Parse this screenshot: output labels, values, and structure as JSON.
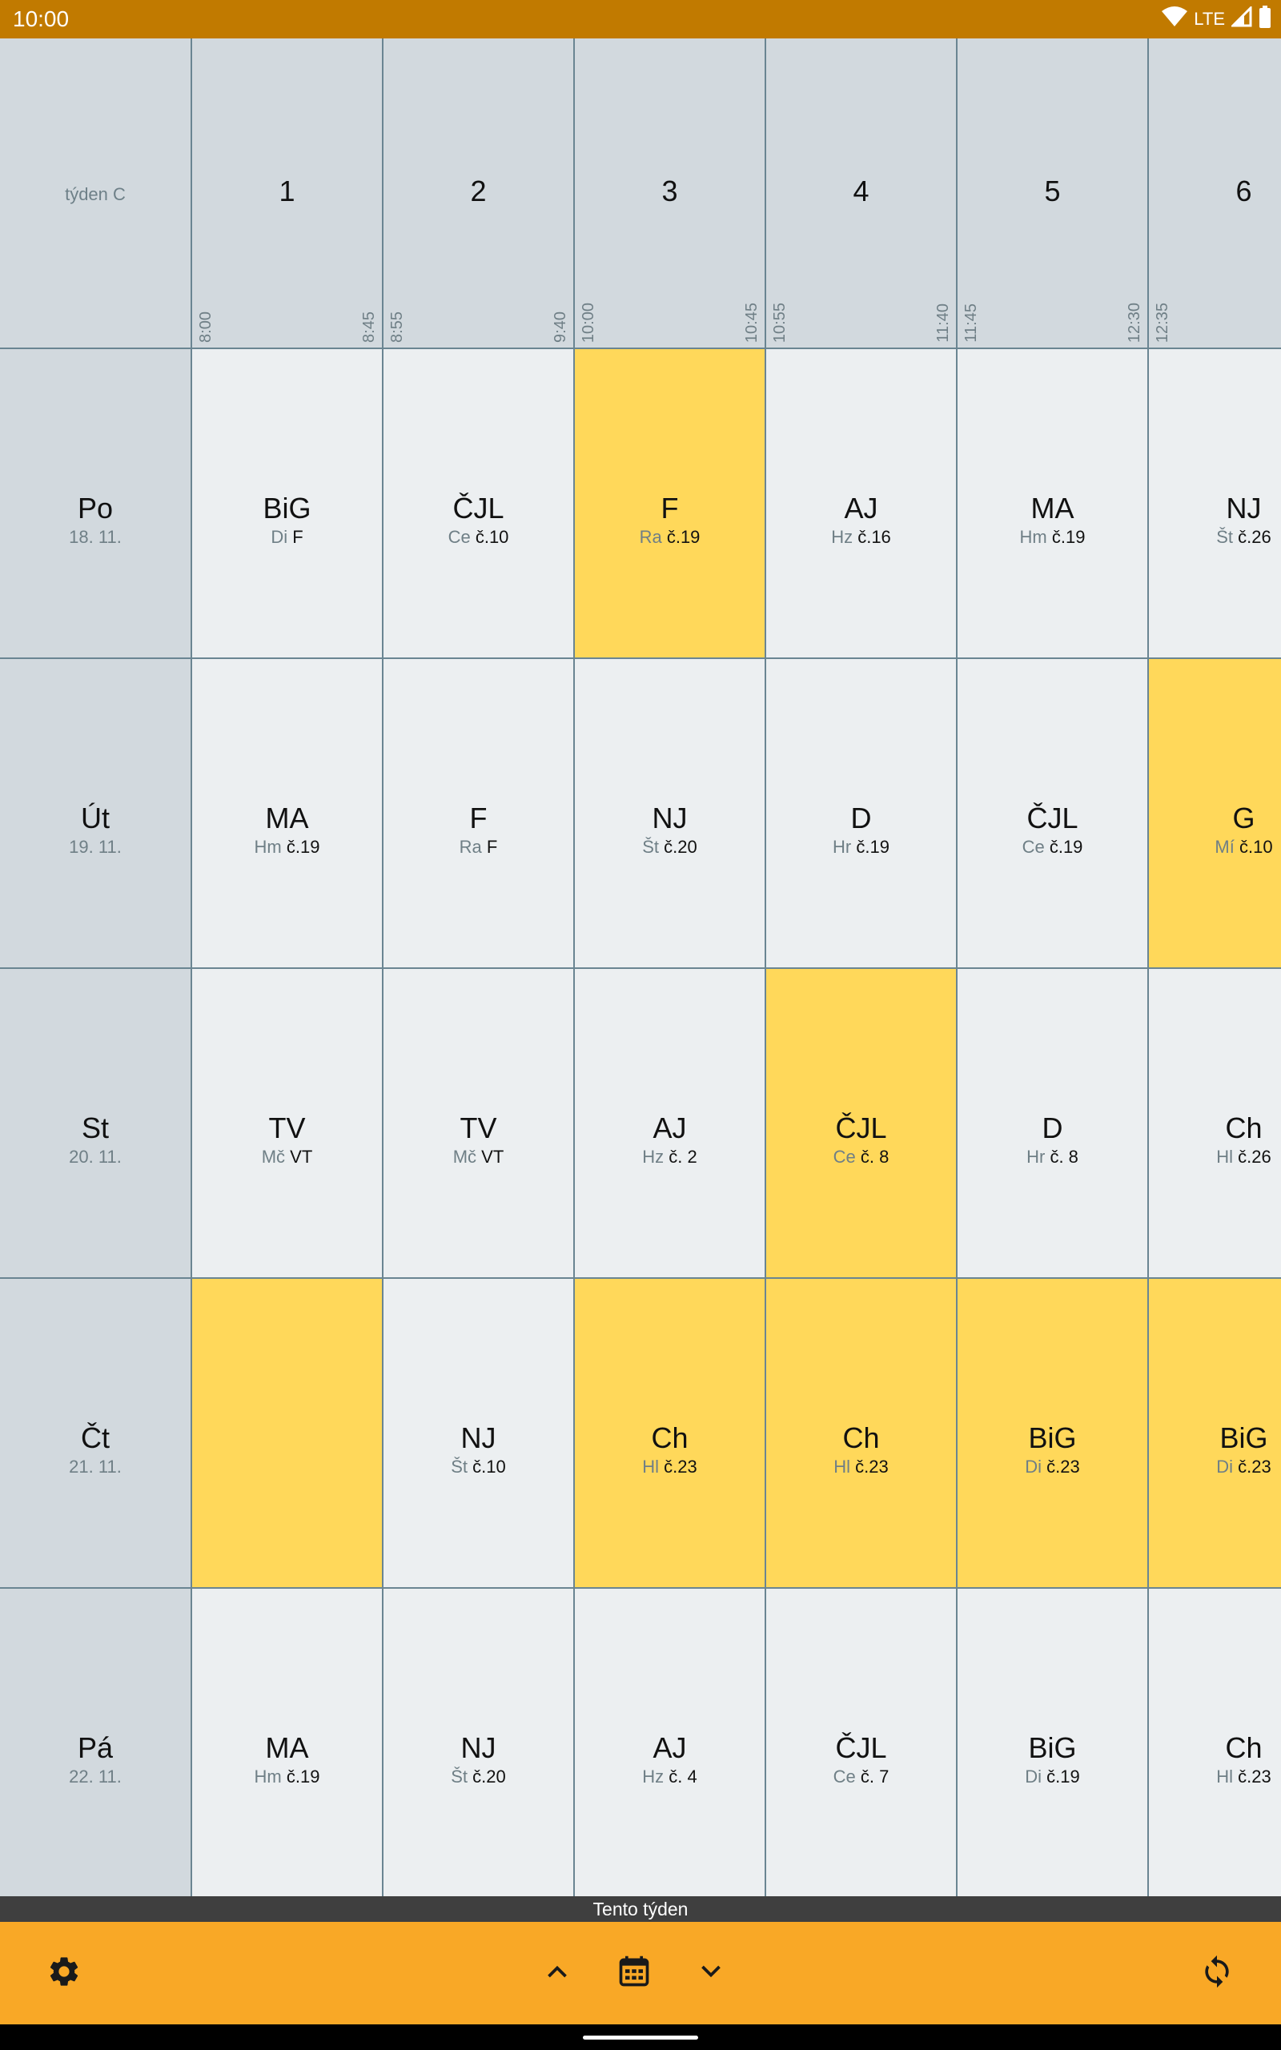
{
  "status_bar": {
    "time": "10:00",
    "network": "LTE"
  },
  "week_label": "týden C",
  "periods": [
    {
      "num": "1",
      "start": "8:00",
      "end": "8:45"
    },
    {
      "num": "2",
      "start": "8:55",
      "end": "9:40"
    },
    {
      "num": "3",
      "start": "10:00",
      "end": "10:45"
    },
    {
      "num": "4",
      "start": "10:55",
      "end": "11:40"
    },
    {
      "num": "5",
      "start": "11:45",
      "end": "12:30"
    },
    {
      "num": "6",
      "start": "12:35",
      "end": ""
    }
  ],
  "days": [
    {
      "name": "Po",
      "date": "18. 11.",
      "lessons": [
        {
          "subject": "BiG",
          "teacher": "Di",
          "room": "F",
          "highlight": false
        },
        {
          "subject": "ČJL",
          "teacher": "Ce",
          "room": "č.10",
          "highlight": false
        },
        {
          "subject": "F",
          "teacher": "Ra",
          "room": "č.19",
          "highlight": true
        },
        {
          "subject": "AJ",
          "teacher": "Hz",
          "room": "č.16",
          "highlight": false
        },
        {
          "subject": "MA",
          "teacher": "Hm",
          "room": "č.19",
          "highlight": false
        },
        {
          "subject": "NJ",
          "teacher": "Št",
          "room": "č.26",
          "highlight": false
        }
      ]
    },
    {
      "name": "Út",
      "date": "19. 11.",
      "lessons": [
        {
          "subject": "MA",
          "teacher": "Hm",
          "room": "č.19",
          "highlight": false
        },
        {
          "subject": "F",
          "teacher": "Ra",
          "room": "F",
          "highlight": false
        },
        {
          "subject": "NJ",
          "teacher": "Št",
          "room": "č.20",
          "highlight": false
        },
        {
          "subject": "D",
          "teacher": "Hr",
          "room": "č.19",
          "highlight": false
        },
        {
          "subject": "ČJL",
          "teacher": "Ce",
          "room": "č.19",
          "highlight": false
        },
        {
          "subject": "G",
          "teacher": "Mí",
          "room": "č.10",
          "highlight": true
        }
      ]
    },
    {
      "name": "St",
      "date": "20. 11.",
      "lessons": [
        {
          "subject": "TV",
          "teacher": "Mč",
          "room": "VT",
          "highlight": false
        },
        {
          "subject": "TV",
          "teacher": "Mč",
          "room": "VT",
          "highlight": false
        },
        {
          "subject": "AJ",
          "teacher": "Hz",
          "room": "č. 2",
          "highlight": false
        },
        {
          "subject": "ČJL",
          "teacher": "Ce",
          "room": "č. 8",
          "highlight": true
        },
        {
          "subject": "D",
          "teacher": "Hr",
          "room": "č. 8",
          "highlight": false
        },
        {
          "subject": "Ch",
          "teacher": "Hl",
          "room": "č.26",
          "highlight": false
        }
      ]
    },
    {
      "name": "Čt",
      "date": "21. 11.",
      "lessons": [
        {
          "subject": "",
          "teacher": "",
          "room": "",
          "highlight": true
        },
        {
          "subject": "NJ",
          "teacher": "Št",
          "room": "č.10",
          "highlight": false
        },
        {
          "subject": "Ch",
          "teacher": "Hl",
          "room": "č.23",
          "highlight": true
        },
        {
          "subject": "Ch",
          "teacher": "Hl",
          "room": "č.23",
          "highlight": true
        },
        {
          "subject": "BiG",
          "teacher": "Di",
          "room": "č.23",
          "highlight": true
        },
        {
          "subject": "BiG",
          "teacher": "Di",
          "room": "č.23",
          "highlight": true
        }
      ]
    },
    {
      "name": "Pá",
      "date": "22. 11.",
      "lessons": [
        {
          "subject": "MA",
          "teacher": "Hm",
          "room": "č.19",
          "highlight": false
        },
        {
          "subject": "NJ",
          "teacher": "Št",
          "room": "č.20",
          "highlight": false
        },
        {
          "subject": "AJ",
          "teacher": "Hz",
          "room": "č. 4",
          "highlight": false
        },
        {
          "subject": "ČJL",
          "teacher": "Ce",
          "room": "č. 7",
          "highlight": false
        },
        {
          "subject": "BiG",
          "teacher": "Di",
          "room": "č.19",
          "highlight": false
        },
        {
          "subject": "Ch",
          "teacher": "Hl",
          "room": "č.23",
          "highlight": false
        }
      ]
    }
  ],
  "week_bar_label": "Tento týden",
  "toolbar": {
    "settings_icon": "gear-icon",
    "prev_icon": "chevron-up-icon",
    "calendar_icon": "calendar-icon",
    "next_icon": "chevron-down-icon",
    "refresh_icon": "refresh-icon"
  },
  "colors": {
    "status_bar": "#c17a00",
    "toolbar": "#f9a826",
    "highlight": "#ffd85a",
    "header": "#d2d9de",
    "cell": "#eceff1"
  }
}
